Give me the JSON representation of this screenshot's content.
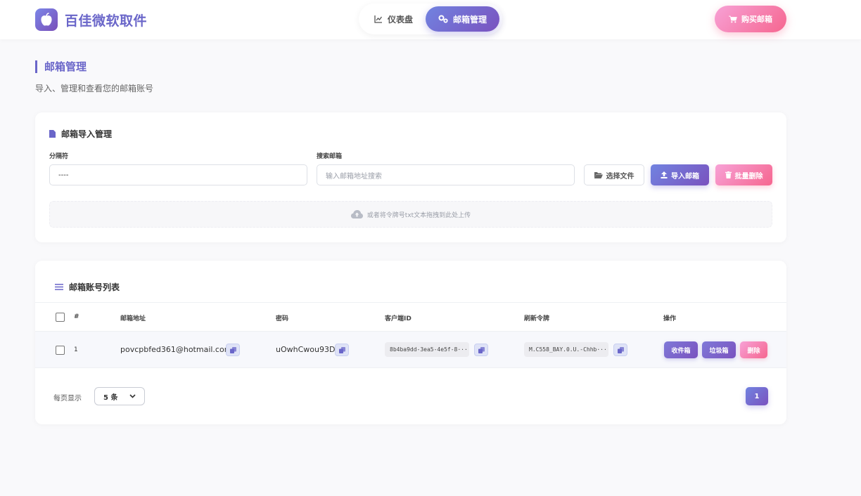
{
  "brand": {
    "title": "百佳微软取件"
  },
  "nav": {
    "items": [
      {
        "label": "仪表盘",
        "icon": "chart-line-icon"
      },
      {
        "label": "邮箱管理",
        "icon": "gears-icon",
        "active": true
      }
    ]
  },
  "header": {
    "buy_label": "购买邮箱"
  },
  "page": {
    "title": "邮箱管理",
    "subtitle": "导入、管理和查看您的邮箱账号"
  },
  "import": {
    "title": "邮箱导入管理",
    "separator_label": "分隔符",
    "separator_value": "----",
    "search_label": "搜索邮箱",
    "search_placeholder": "输入邮箱地址搜索",
    "choose_file_label": "选择文件",
    "import_label": "导入邮箱",
    "bulk_delete_label": "批量删除",
    "dropzone_text": "或者将令牌号txt文本拖拽到此处上传"
  },
  "list": {
    "title": "邮箱账号列表",
    "columns": [
      "#",
      "邮箱地址",
      "密码",
      "客户端ID",
      "刷新令牌",
      "操作"
    ],
    "rows": [
      {
        "index": "1",
        "email": "povcpbfed361@hotmail.com",
        "password": "uOwhCwou93D",
        "client_id": "8b4ba9dd-3ea5-4e5f-8···",
        "refresh_token": "M.C558_BAY.0.U.-Chhb···",
        "actions": {
          "inbox": "收件箱",
          "junk": "垃圾箱",
          "delete": "删除"
        }
      }
    ],
    "per_page_label": "每页显示",
    "per_page_value": "5 条",
    "current_page": "1"
  },
  "colors": {
    "primary": "#6a66c9",
    "gradient_purple_start": "#7183e0",
    "gradient_purple_end": "#7a52bf",
    "gradient_pink_start": "#f7a1d6",
    "gradient_pink_end": "#f6668f"
  }
}
